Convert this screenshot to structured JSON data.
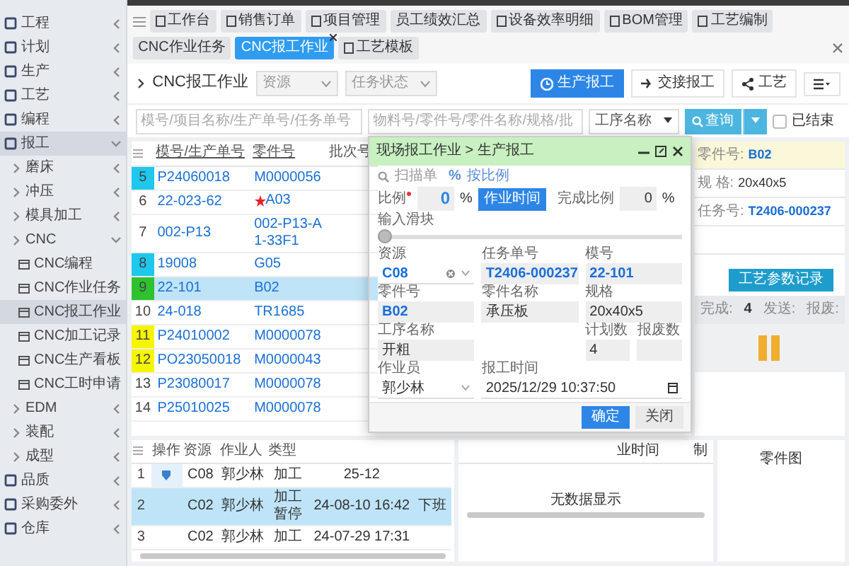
{
  "sidebar": {
    "items": [
      {
        "label": "工程",
        "expanded": false,
        "selected": false
      },
      {
        "label": "计划",
        "expanded": false,
        "selected": false
      },
      {
        "label": "生产",
        "expanded": false,
        "selected": false
      },
      {
        "label": "工艺",
        "expanded": false,
        "selected": false
      },
      {
        "label": "编程",
        "expanded": false,
        "selected": false
      },
      {
        "label": "报工",
        "expanded": true,
        "selected": true,
        "children": [
          {
            "label": "磨床",
            "expanded": false,
            "selected": false
          },
          {
            "label": "冲压",
            "expanded": false,
            "selected": false
          },
          {
            "label": "模具加工",
            "expanded": false,
            "selected": false
          },
          {
            "label": "CNC",
            "expanded": true,
            "selected": false,
            "children": [
              {
                "label": "CNC编程",
                "selected": false
              },
              {
                "label": "CNC作业任务",
                "selected": false
              },
              {
                "label": "CNC报工作业",
                "selected": true
              },
              {
                "label": "CNC加工记录",
                "selected": false
              },
              {
                "label": "CNC生产看板",
                "selected": false
              },
              {
                "label": "CNC工时申请",
                "selected": false
              }
            ]
          },
          {
            "label": "EDM",
            "expanded": false,
            "selected": false
          },
          {
            "label": "装配",
            "expanded": false,
            "selected": false
          },
          {
            "label": "成型",
            "expanded": false,
            "selected": false
          }
        ]
      },
      {
        "label": "品质",
        "expanded": false,
        "selected": false
      },
      {
        "label": "采购委外",
        "expanded": false,
        "selected": false
      },
      {
        "label": "仓库",
        "expanded": false,
        "selected": false
      }
    ]
  },
  "tabs": [
    {
      "label": "工作台",
      "has_icon": true,
      "selected": false
    },
    {
      "label": "销售订单",
      "has_icon": true,
      "selected": false
    },
    {
      "label": "项目管理",
      "has_icon": true,
      "selected": false
    },
    {
      "label": "员工绩效汇总",
      "has_icon": false,
      "selected": false
    },
    {
      "label": "设备效率明细",
      "has_icon": true,
      "selected": false
    },
    {
      "label": "BOM管理",
      "has_icon": true,
      "selected": false
    },
    {
      "label": "工艺编制",
      "has_icon": true,
      "selected": false
    },
    {
      "label": "CNC作业任务",
      "has_icon": false,
      "selected": false
    },
    {
      "label": "CNC报工作业",
      "has_icon": false,
      "selected": true
    },
    {
      "label": "工艺模板",
      "has_icon": true,
      "selected": false
    }
  ],
  "header": {
    "title": "CNC报工作业",
    "filters": [
      "资源",
      "任务状态"
    ],
    "buttons": [
      {
        "label": "生产报工",
        "selected": true
      },
      {
        "label": "交接报工",
        "selected": false
      },
      {
        "label": "工艺",
        "selected": false
      }
    ]
  },
  "search": {
    "fields": [
      {
        "placeholder": "模号/项目名称/生产单号/任务单号"
      },
      {
        "placeholder": "物料号/零件号/零件名称/规格/批"
      }
    ],
    "select": "工序名称",
    "button": "查询",
    "checkbox": {
      "label": "已结束",
      "checked": false
    }
  },
  "table": {
    "columns": [
      "模号/生产单号",
      "零件号",
      "批次号"
    ],
    "rows": [
      {
        "index": "5",
        "color": "#1ec8ec",
        "mold_no": "P24060018",
        "part_no": "M0000056",
        "starred": false,
        "selected": false
      },
      {
        "index": "6",
        "mold_no": "22-023-62",
        "part_no": "A03",
        "starred": true,
        "selected": false
      },
      {
        "index": "7",
        "mold_no": "002-P13",
        "part_no": "002-P13-A1-33F1",
        "starred": false,
        "selected": false
      },
      {
        "index": "8",
        "color": "#1ec8ec",
        "mold_no": "19008",
        "part_no": "G05",
        "starred": false,
        "selected": false
      },
      {
        "index": "9",
        "color": "#2fc22f",
        "mold_no": "22-101",
        "part_no": "B02",
        "starred": false,
        "selected": true
      },
      {
        "index": "10",
        "mold_no": "24-018",
        "part_no": "TR1685",
        "starred": false,
        "selected": false
      },
      {
        "index": "11",
        "color": "#f5f500",
        "mold_no": "P24010002",
        "part_no": "M0000078",
        "starred": false,
        "selected": false
      },
      {
        "index": "12",
        "color": "#f5f500",
        "mold_no": "PO23050018",
        "part_no": "M0000043",
        "starred": false,
        "selected": false
      },
      {
        "index": "13",
        "mold_no": "P23080017",
        "part_no": "M0000078",
        "starred": false,
        "selected": false
      },
      {
        "index": "14",
        "mold_no": "P25010025",
        "part_no": "M0000078",
        "starred": false,
        "selected": false
      }
    ]
  },
  "info": {
    "fields": [
      {
        "label": "零件号:",
        "value": "B02",
        "link": true,
        "highlighted": true
      },
      {
        "label": "规 格:",
        "value": "20x40x5",
        "link": false,
        "highlighted": false
      },
      {
        "label": "任务号:",
        "value": "T2406-000237",
        "link": true,
        "highlighted": false
      }
    ],
    "button": "工艺参数记录",
    "stats": [
      {
        "label": "完成:",
        "value": "4"
      },
      {
        "label": "发送:"
      },
      {
        "label": "报废:"
      }
    ]
  },
  "modal": {
    "title": "现场报工作业 > 生产报工",
    "links": [
      {
        "kind": "search",
        "label": "扫描单"
      },
      {
        "kind": "percent",
        "symbol": "%",
        "label": "按比例"
      }
    ],
    "ratio": {
      "label": "比例",
      "required": true,
      "value": "0",
      "unit": "%",
      "button": "作业时间",
      "done_label": "完成比例",
      "done_value": "0",
      "done_unit": "%"
    },
    "slider": {
      "label": "输入滑块",
      "level": 0
    },
    "fields": [
      {
        "label": "资源",
        "value": "C08",
        "kind": "select",
        "link": true
      },
      {
        "label": "任务单号",
        "value": "T2406-000237",
        "kind": "text",
        "link": true
      },
      {
        "label": "模号",
        "value": "22-101",
        "kind": "text",
        "link": true
      },
      {
        "label": "零件号",
        "value": "B02",
        "kind": "text",
        "link": true
      },
      {
        "label": "零件名称",
        "value": "承压板",
        "kind": "text",
        "link": false
      },
      {
        "label": "规格",
        "value": "20x40x5",
        "kind": "text",
        "link": false
      },
      {
        "label": "工序名称",
        "value": "开粗",
        "kind": "text",
        "link": false
      },
      {
        "label": "计划数",
        "value": "4",
        "kind": "text",
        "link": false
      },
      {
        "label": "报废数",
        "kind": "text"
      },
      {
        "label": "作业员",
        "value": "郭少林",
        "kind": "select",
        "link": false
      },
      {
        "label": "报工时间",
        "value": "2025/12/29 10:37:50",
        "kind": "datetime",
        "link": false
      }
    ],
    "buttons": [
      {
        "label": "确定",
        "kind": "primary"
      },
      {
        "label": "关闭",
        "kind": "secondary"
      }
    ]
  },
  "records": {
    "columns": [
      "操作",
      "资源",
      "作业人",
      "类型"
    ],
    "rows": [
      {
        "index": "1",
        "has_action": true,
        "resource": "C08",
        "worker": "郭少林",
        "type": "加工",
        "time": "25-12",
        "selected": false
      },
      {
        "index": "2",
        "has_action": false,
        "resource": "C02",
        "worker": "郭少林",
        "type": "加工暂停",
        "time": "24-08-10 16:42",
        "note": "下班",
        "selected": true
      },
      {
        "index": "3",
        "has_action": false,
        "resource": "C02",
        "worker": "郭少林",
        "type": "加工",
        "time": "24-07-29 17:31",
        "selected": false
      }
    ]
  },
  "log": {
    "columns": [
      "业时间",
      "制"
    ],
    "empty_text": "无数据显示"
  },
  "drawing_panel": {
    "title": "零件图"
  }
}
